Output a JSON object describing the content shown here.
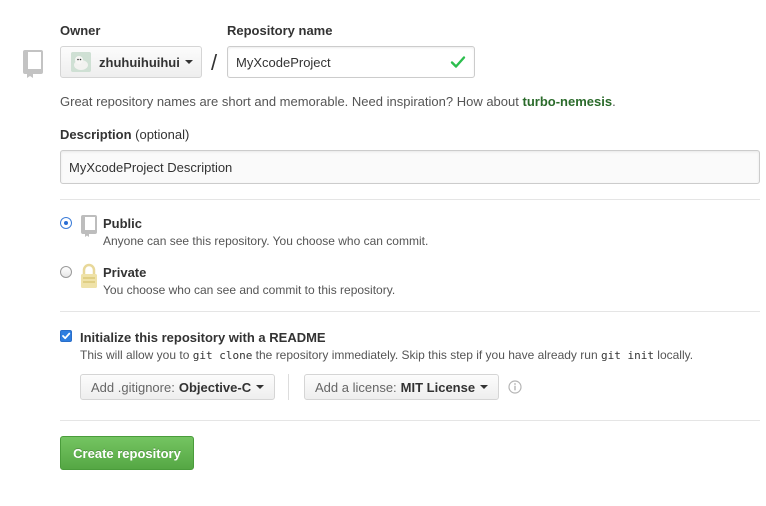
{
  "owner": {
    "label": "Owner",
    "username": "zhuhuihuihui"
  },
  "repo_name": {
    "label": "Repository name",
    "value": "MyXcodeProject",
    "separator": "/"
  },
  "hint": {
    "text": "Great repository names are short and memorable. Need inspiration? How about",
    "suggestion": "turbo-nemesis",
    "end": "."
  },
  "description": {
    "label": "Description",
    "optional": "(optional)",
    "value": "MyXcodeProject Description"
  },
  "visibility": {
    "selected": "public",
    "public": {
      "title": "Public",
      "desc": "Anyone can see this repository. You choose who can commit."
    },
    "private": {
      "title": "Private",
      "desc": "You choose who can see and commit to this repository."
    }
  },
  "init": {
    "checked": true,
    "title": "Initialize this repository with a README",
    "desc_1": "This will allow you to",
    "code_1": "git clone",
    "desc_2": "the repository immediately. Skip this step if you have already run",
    "code_2": "git init",
    "desc_3": "locally."
  },
  "gitignore": {
    "prefix": "Add .gitignore:",
    "value": "Objective-C"
  },
  "license": {
    "prefix": "Add a license:",
    "value": "MIT License"
  },
  "create_button": "Create repository",
  "colors": {
    "accent_green": "#55a744",
    "suggestion_green": "#2b6b2b",
    "check_green": "#2cbe4e",
    "checkbox_blue": "#2e7ee0"
  }
}
